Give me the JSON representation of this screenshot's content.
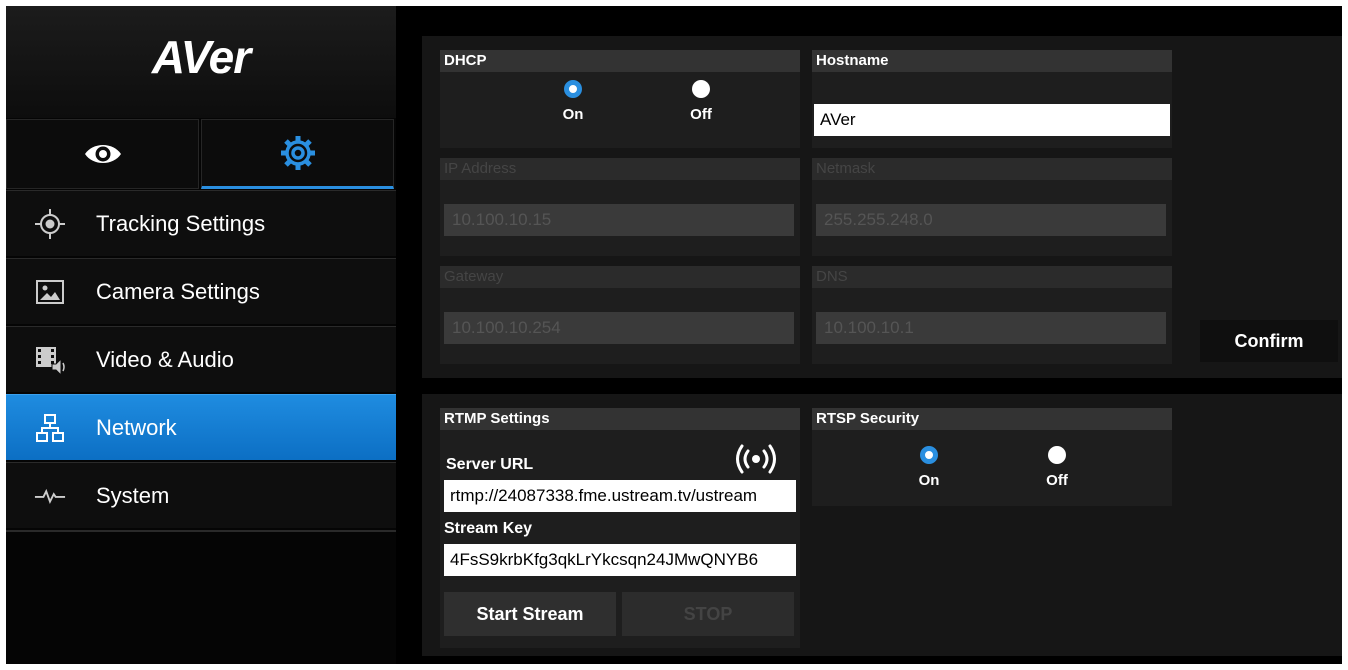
{
  "brand": {
    "logo_text": "AVer"
  },
  "mode_tabs": [
    {
      "id": "view",
      "icon": "eye-icon",
      "active": false
    },
    {
      "id": "settings",
      "icon": "gear-icon",
      "active": true
    }
  ],
  "sidebar": {
    "items": [
      {
        "label": "Tracking Settings",
        "icon": "crosshair-icon"
      },
      {
        "label": "Camera Settings",
        "icon": "image-icon"
      },
      {
        "label": "Video & Audio",
        "icon": "video-audio-icon"
      },
      {
        "label": "Network",
        "icon": "network-icon",
        "active": true
      },
      {
        "label": "System",
        "icon": "pulse-icon"
      }
    ]
  },
  "network": {
    "dhcp": {
      "title": "DHCP",
      "on_label": "On",
      "off_label": "Off",
      "selected": "On"
    },
    "hostname": {
      "title": "Hostname",
      "value": "AVer"
    },
    "ip_address": {
      "title": "IP Address",
      "value": "10.100.10.15"
    },
    "netmask": {
      "title": "Netmask",
      "value": "255.255.248.0"
    },
    "gateway": {
      "title": "Gateway",
      "value": "10.100.10.254"
    },
    "dns": {
      "title": "DNS",
      "value": "10.100.10.1"
    },
    "confirm_label": "Confirm"
  },
  "rtmp": {
    "title": "RTMP Settings",
    "server_url_label": "Server URL",
    "server_url_value": "rtmp://24087338.fme.ustream.tv/ustream",
    "stream_key_label": "Stream Key",
    "stream_key_value": "4FsS9krbKfg3qkLrYkcsqn24JMwQNYB6",
    "start_label": "Start Stream",
    "stop_label": "STOP",
    "broadcast_icon": "broadcast-icon"
  },
  "rtsp": {
    "title": "RTSP Security",
    "on_label": "On",
    "off_label": "Off",
    "selected": "On"
  },
  "colors": {
    "accent": "#2a8fe0",
    "panel": "#1e1e1e",
    "background": "#000000"
  }
}
